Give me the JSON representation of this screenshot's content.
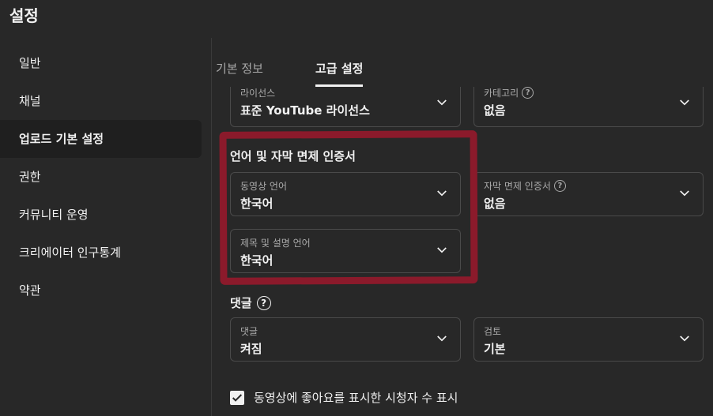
{
  "header": {
    "title": "설정"
  },
  "sidebar": {
    "items": [
      {
        "label": "일반",
        "active": false
      },
      {
        "label": "채널",
        "active": false
      },
      {
        "label": "업로드 기본 설정",
        "active": true
      },
      {
        "label": "권한",
        "active": false
      },
      {
        "label": "커뮤니티 운영",
        "active": false
      },
      {
        "label": "크리에이터 인구통계",
        "active": false
      },
      {
        "label": "약관",
        "active": false
      }
    ]
  },
  "tabs": [
    {
      "label": "기본 정보",
      "active": false
    },
    {
      "label": "고급 설정",
      "active": true
    }
  ],
  "license": {
    "label": "라이선스",
    "value": "표준 YouTube 라이선스"
  },
  "category": {
    "label": "카테고리",
    "value": "없음"
  },
  "language_section": {
    "title": "언어 및 자막 면제 인증서"
  },
  "video_language": {
    "label": "동영상 언어",
    "value": "한국어"
  },
  "caption_cert": {
    "label": "자막 면제 인증서",
    "value": "없음"
  },
  "title_language": {
    "label": "제목 및 설명 언어",
    "value": "한국어"
  },
  "comments_section": {
    "title": "댓글"
  },
  "comments": {
    "label": "댓글",
    "value": "켜짐"
  },
  "review": {
    "label": "검토",
    "value": "기본"
  },
  "like_count": {
    "label": "동영상에 좋아요를 표시한 시청자 수 표시",
    "checked": true
  },
  "colors": {
    "background": "#282828",
    "active_nav": "#1f1f1f",
    "highlight": "#8b1a2b"
  }
}
